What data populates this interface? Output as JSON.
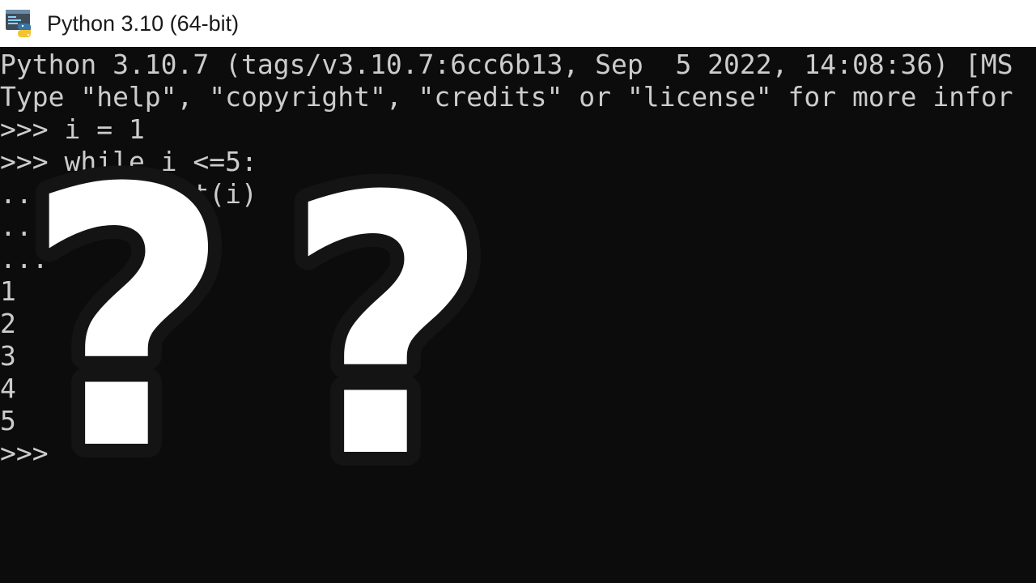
{
  "window": {
    "title": "Python 3.10 (64-bit)",
    "icon": "python-terminal-icon"
  },
  "console": {
    "lines": [
      "Python 3.10.7 (tags/v3.10.7:6cc6b13, Sep  5 2022, 14:08:36) [MS",
      "Type \"help\", \"copyright\", \"credits\" or \"license\" for more infor",
      ">>> i = 1",
      ">>> while i <=5:",
      "...     print(i)",
      "...",
      "...",
      "1",
      "2",
      "3",
      "4",
      "5",
      ">>>"
    ]
  },
  "overlay": {
    "icon": "question-marks-icon",
    "glyph": "??",
    "fill_color": "#ffffff",
    "outline_color": "#141414"
  },
  "colors": {
    "console_background": "#0c0c0c",
    "console_text": "#cccccc",
    "titlebar_background": "#ffffff"
  }
}
